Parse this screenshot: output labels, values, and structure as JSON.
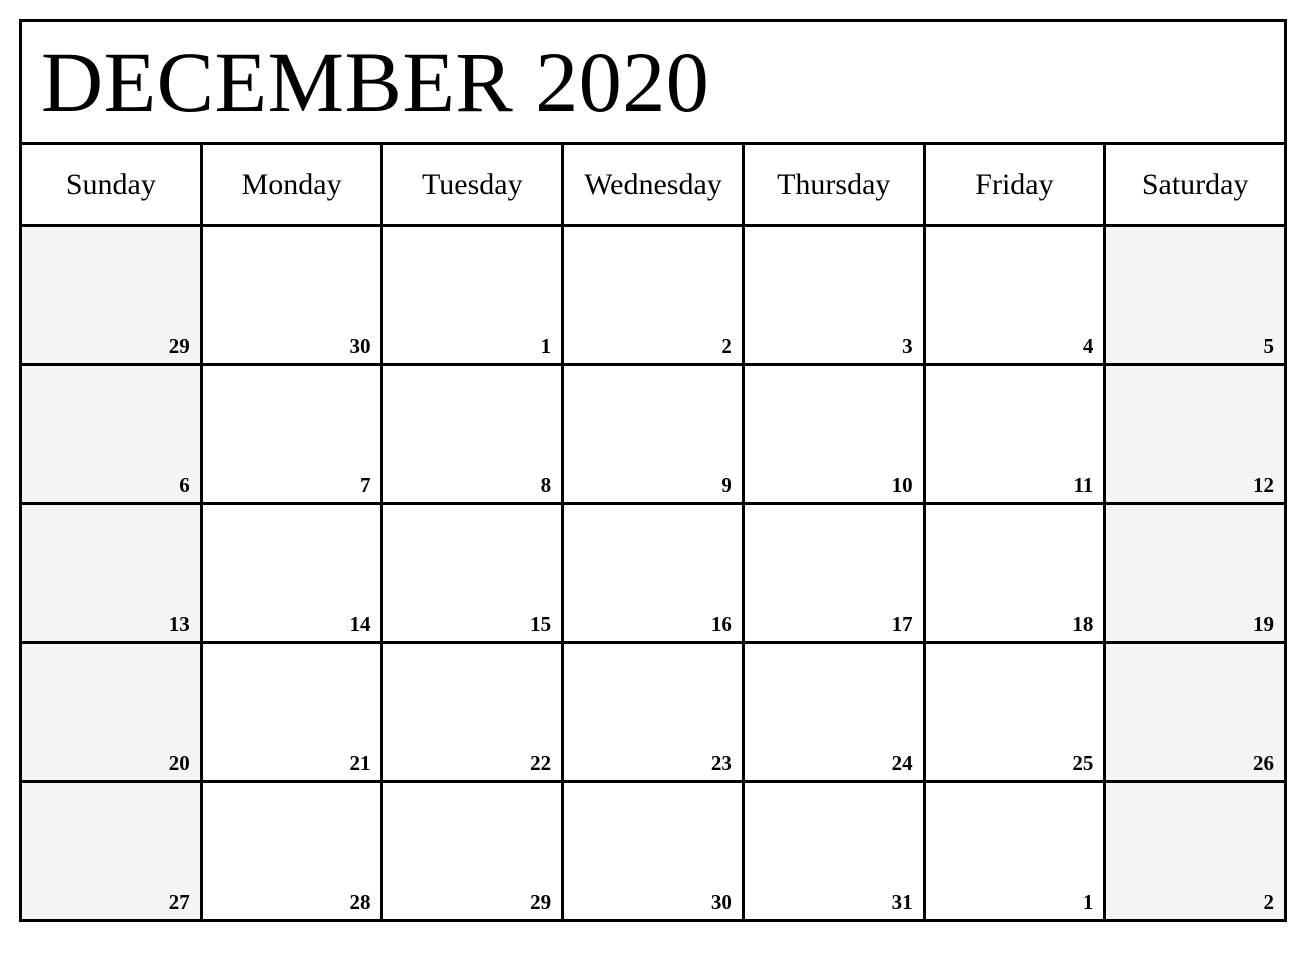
{
  "calendar": {
    "title": "DECEMBER 2020",
    "month": "DECEMBER",
    "year": "2020",
    "colors": {
      "border": "#000000",
      "weekend_background": "#f4f4f4",
      "weekday_background": "#ffffff",
      "text": "#000000"
    },
    "weekday_headers": [
      {
        "label": "Sunday"
      },
      {
        "label": "Monday"
      },
      {
        "label": "Tuesday"
      },
      {
        "label": "Wednesday"
      },
      {
        "label": "Thursday"
      },
      {
        "label": "Friday"
      },
      {
        "label": "Saturday"
      }
    ],
    "weeks": [
      {
        "days": [
          {
            "number": "29",
            "weekend": true
          },
          {
            "number": "30",
            "weekend": false
          },
          {
            "number": "1",
            "weekend": false
          },
          {
            "number": "2",
            "weekend": false
          },
          {
            "number": "3",
            "weekend": false
          },
          {
            "number": "4",
            "weekend": false
          },
          {
            "number": "5",
            "weekend": true
          }
        ]
      },
      {
        "days": [
          {
            "number": "6",
            "weekend": true
          },
          {
            "number": "7",
            "weekend": false
          },
          {
            "number": "8",
            "weekend": false
          },
          {
            "number": "9",
            "weekend": false
          },
          {
            "number": "10",
            "weekend": false
          },
          {
            "number": "11",
            "weekend": false
          },
          {
            "number": "12",
            "weekend": true
          }
        ]
      },
      {
        "days": [
          {
            "number": "13",
            "weekend": true
          },
          {
            "number": "14",
            "weekend": false
          },
          {
            "number": "15",
            "weekend": false
          },
          {
            "number": "16",
            "weekend": false
          },
          {
            "number": "17",
            "weekend": false
          },
          {
            "number": "18",
            "weekend": false
          },
          {
            "number": "19",
            "weekend": true
          }
        ]
      },
      {
        "days": [
          {
            "number": "20",
            "weekend": true
          },
          {
            "number": "21",
            "weekend": false
          },
          {
            "number": "22",
            "weekend": false
          },
          {
            "number": "23",
            "weekend": false
          },
          {
            "number": "24",
            "weekend": false
          },
          {
            "number": "25",
            "weekend": false
          },
          {
            "number": "26",
            "weekend": true
          }
        ]
      },
      {
        "days": [
          {
            "number": "27",
            "weekend": true
          },
          {
            "number": "28",
            "weekend": false
          },
          {
            "number": "29",
            "weekend": false
          },
          {
            "number": "30",
            "weekend": false
          },
          {
            "number": "31",
            "weekend": false
          },
          {
            "number": "1",
            "weekend": false
          },
          {
            "number": "2",
            "weekend": true
          }
        ]
      }
    ]
  }
}
